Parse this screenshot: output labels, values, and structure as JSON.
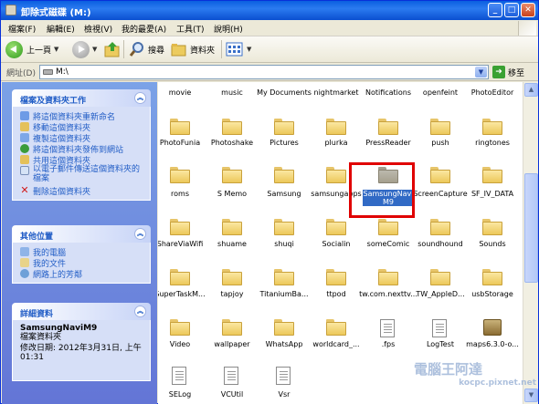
{
  "window": {
    "title": "卸除式磁碟 (M:)"
  },
  "menu": [
    "檔案(F)",
    "編輯(E)",
    "檢視(V)",
    "我的最愛(A)",
    "工具(T)",
    "說明(H)"
  ],
  "toolbar": {
    "back_label": "上一頁",
    "search_label": "搜尋",
    "folders_label": "資料夾"
  },
  "address": {
    "label": "網址(D)",
    "value": "M:\\",
    "go_label": "移至"
  },
  "tasks_panel": {
    "title": "檔案及資料夾工作",
    "items": [
      "將這個資料夾重新命名",
      "移動這個資料夾",
      "複製這個資料夾",
      "將這個資料夾發佈到網站",
      "共用這個資料夾",
      "以電子郵件傳送這個資料夾的檔案",
      "刪除這個資料夾"
    ]
  },
  "places_panel": {
    "title": "其他位置",
    "items": [
      "我的電腦",
      "我的文件",
      "網路上的芳鄰"
    ]
  },
  "details_panel": {
    "title": "詳細資料",
    "name": "SamsungNaviM9",
    "type": "檔案資料夾",
    "modified": "修改日期: 2012年3月31日, 上午 01:31"
  },
  "files": {
    "row0": [
      "movie",
      "music",
      "My Documents",
      "nightmarket",
      "Notifications",
      "openfeint",
      "PhotoEditor"
    ],
    "row1": [
      "PhotoFunia",
      "Photoshake",
      "Pictures",
      "plurka",
      "PressReader",
      "push",
      "ringtones"
    ],
    "row2": [
      "roms",
      "S Memo",
      "Samsung",
      "samsungapps",
      "SamsungNaviM9",
      "ScreenCapture",
      "SF_IV_DATA"
    ],
    "row3": [
      "ShareViaWifi",
      "shuame",
      "shuqi",
      "Socialin",
      "someComic",
      "soundhound",
      "Sounds"
    ],
    "row4": [
      "SuperTaskM...",
      "tapjoy",
      "TitaniumBa...",
      "ttpod",
      "tw.com.nexttv...",
      "TW_AppleD...",
      "usbStorage"
    ],
    "row5": [
      "Video",
      "wallpaper",
      "WhatsApp",
      "worldcard_...",
      ".fps",
      "LogTest",
      "maps6.3.0-o..."
    ],
    "row6": [
      "SELog",
      "VCUtil",
      "Vsr"
    ]
  },
  "selected_item": "SamsungNaviM9",
  "watermark": {
    "line1": "電腦王阿達",
    "line2": "kocpc.pixnet.net"
  },
  "colors": {
    "titlebar": "#0a5fe0",
    "leftpane": "#6b8be0",
    "link": "#215dc6",
    "selection": "#316ac5",
    "highlight_box": "#e00000"
  }
}
